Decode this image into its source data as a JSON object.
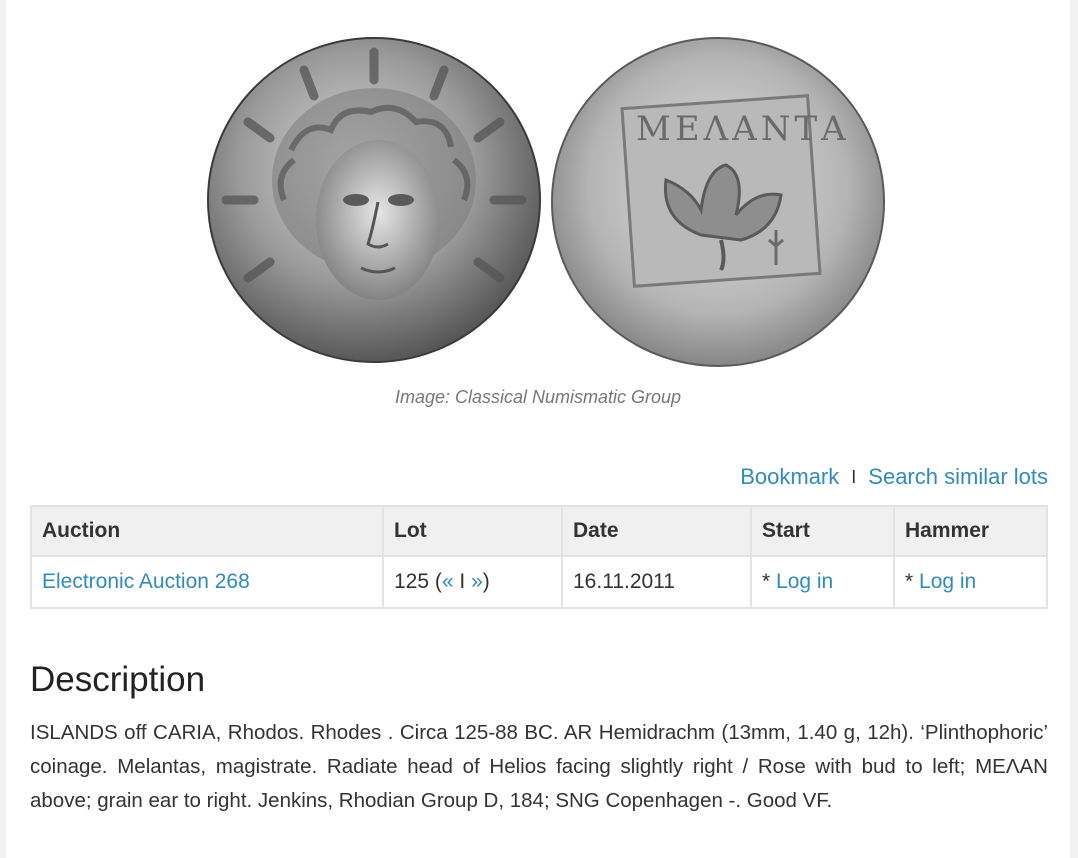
{
  "image": {
    "credit": "Image: Classical Numismatic Group",
    "reverse_inscription": "ΜΕΛΑΝΤΑ"
  },
  "actions": {
    "bookmark": "Bookmark",
    "separator": "I",
    "search_similar": "Search similar lots"
  },
  "table": {
    "headers": [
      "Auction",
      "Lot",
      "Date",
      "Start",
      "Hammer"
    ],
    "row": {
      "auction": "Electronic Auction 268",
      "lot_number": "125",
      "lot_open": " (",
      "prev": "«",
      "lot_sep": " I ",
      "next": "»",
      "lot_close": ")",
      "date": "16.11.2011",
      "start_prefix": "* ",
      "start_login": "Log in",
      "hammer_prefix": "* ",
      "hammer_login": "Log in"
    }
  },
  "description": {
    "title": "Description",
    "text": "ISLANDS off CARIA, Rhodos. Rhodes . Circa 125-88 BC. AR Hemidrachm (13mm, 1.40 g, 12h). ‘Plinthophoric’ coinage. Melantas, magistrate. Radiate head of Helios facing slightly right / Rose with bud to left; ΜΕΛΑΝ above; grain ear to right. Jenkins, Rhodian Group D, 184; SNG Copenhagen -. Good VF."
  },
  "colors": {
    "link": "#2f8bbf",
    "header_bg": "#f0f0f0",
    "border": "#e3e3e3"
  }
}
